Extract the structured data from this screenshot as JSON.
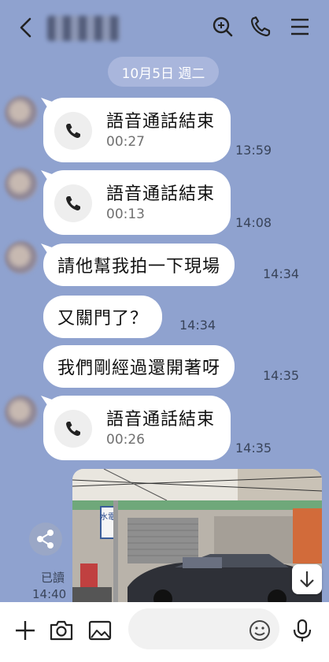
{
  "colors": {
    "chat_background": "#8fa2cf",
    "bubble": "#ffffff",
    "date_pill": "#a9b6dc"
  },
  "header": {
    "icons": [
      "back-icon",
      "search-icon",
      "phone-icon",
      "menu-icon"
    ]
  },
  "date_label": "10月5日 週二",
  "messages": [
    {
      "type": "call",
      "title": "語音通話結束",
      "duration": "00:27",
      "time": "13:59"
    },
    {
      "type": "call",
      "title": "語音通話結束",
      "duration": "00:13",
      "time": "14:08"
    },
    {
      "type": "text",
      "text": "請他幫我拍一下現場",
      "time": "14:34"
    },
    {
      "type": "text",
      "text": "又關門了？",
      "time": "14:34"
    },
    {
      "type": "text",
      "text": "我們剛經過還開著呀",
      "time": "14:35"
    },
    {
      "type": "call",
      "title": "語音通話結束",
      "duration": "00:26",
      "time": "14:35"
    }
  ],
  "photo_message": {
    "read_label": "已讀",
    "time": "14:40",
    "sign_text": "水電"
  },
  "bottom_bar": {
    "input_placeholder": "",
    "icons": [
      "plus-icon",
      "camera-icon",
      "image-icon",
      "emoji-icon",
      "microphone-icon"
    ]
  }
}
